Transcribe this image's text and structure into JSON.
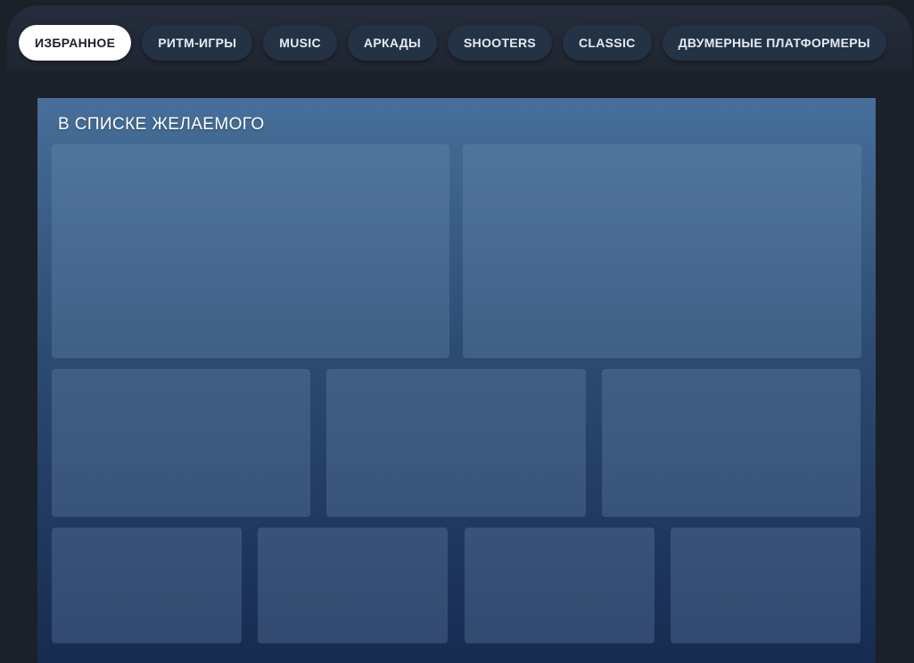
{
  "tabs": [
    {
      "label": "ИЗБРАННОЕ",
      "active": true
    },
    {
      "label": "РИТМ-ИГРЫ",
      "active": false
    },
    {
      "label": "MUSIC",
      "active": false
    },
    {
      "label": "АРКАДЫ",
      "active": false
    },
    {
      "label": "SHOOTERS",
      "active": false
    },
    {
      "label": "CLASSIC",
      "active": false
    },
    {
      "label": "ДВУМЕРНЫЕ ПЛАТФОРМЕРЫ",
      "active": false
    }
  ],
  "wishlist": {
    "title": "В СПИСКЕ ЖЕЛАЕМОГО"
  }
}
